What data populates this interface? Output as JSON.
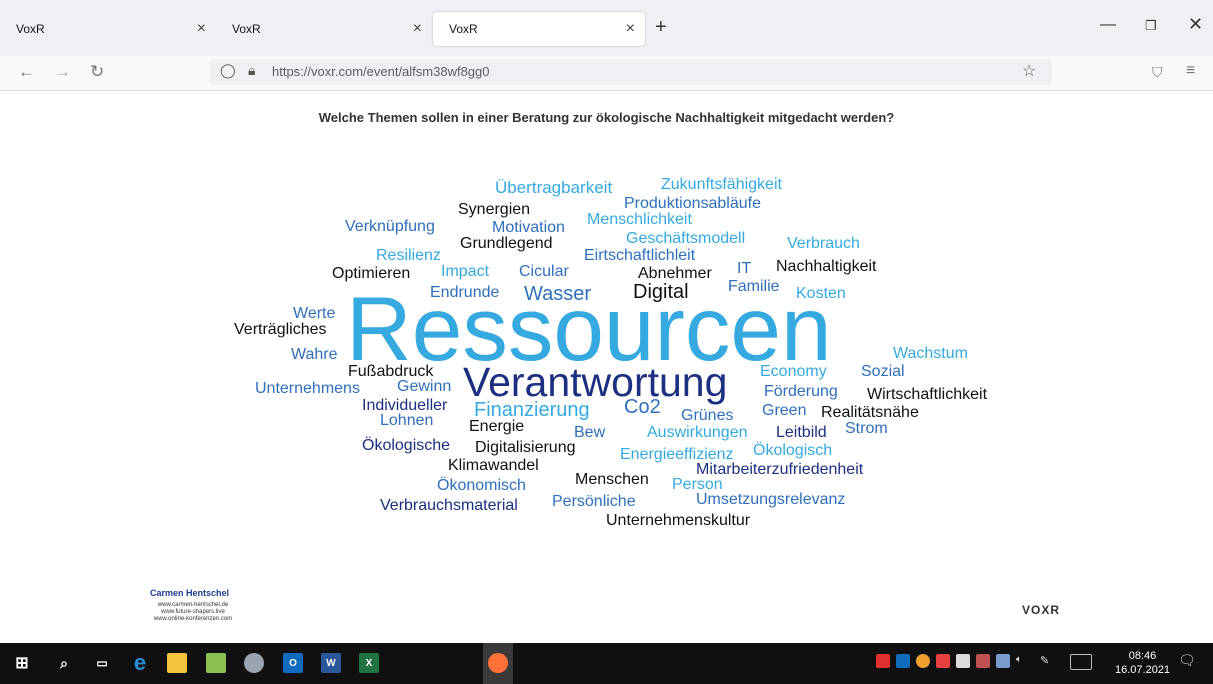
{
  "browser": {
    "tabs": [
      {
        "label": "VoxR"
      },
      {
        "label": "VoxR"
      },
      {
        "label": "VoxR"
      }
    ],
    "url": "https://voxr.com/event/alfsm38wf8gg0"
  },
  "page": {
    "question": "Welche Themen sollen in einer Beratung zur ökologische Nachhaltigkeit mitgedacht werden?",
    "footer": {
      "name": "Carmen Hentschel",
      "lines": [
        "www.carmen-hentschel.de",
        "www.future-shapers.live",
        "www.online-konferenzen.com"
      ],
      "logo": "VOXR"
    }
  },
  "colors": {
    "light_blue": "#35a9e0",
    "mid_blue": "#2f6fbb",
    "dark_blue": "#1c2f80",
    "black": "#111111"
  },
  "word_cloud": [
    {
      "text": "Ressourcen",
      "color": "light_blue"
    },
    {
      "text": "Verantwortung",
      "color": "dark_blue"
    },
    {
      "text": "Wasser",
      "color": "mid_blue"
    },
    {
      "text": "Digital",
      "color": "black"
    },
    {
      "text": "Finanzierung",
      "color": "light_blue"
    },
    {
      "text": "Co2",
      "color": "mid_blue"
    },
    {
      "text": "Übertragbarkeit",
      "color": "light_blue"
    },
    {
      "text": "Zukunftsfähigkeit",
      "color": "light_blue"
    },
    {
      "text": "Synergien",
      "color": "black"
    },
    {
      "text": "Produktionsabläufe",
      "color": "mid_blue"
    },
    {
      "text": "Verknüpfung",
      "color": "mid_blue"
    },
    {
      "text": "Motivation",
      "color": "mid_blue"
    },
    {
      "text": "Menschlichkeit",
      "color": "light_blue"
    },
    {
      "text": "Grundlegend",
      "color": "black"
    },
    {
      "text": "Geschäftsmodell",
      "color": "light_blue"
    },
    {
      "text": "Verbrauch",
      "color": "light_blue"
    },
    {
      "text": "Resilienz",
      "color": "light_blue"
    },
    {
      "text": "Eirtschaftlichleit",
      "color": "mid_blue"
    },
    {
      "text": "Optimieren",
      "color": "black"
    },
    {
      "text": "Impact",
      "color": "light_blue"
    },
    {
      "text": "Cicular",
      "color": "mid_blue"
    },
    {
      "text": "Abnehmer",
      "color": "black"
    },
    {
      "text": "IT",
      "color": "mid_blue"
    },
    {
      "text": "Nachhaltigkeit",
      "color": "black"
    },
    {
      "text": "Endrunde",
      "color": "mid_blue"
    },
    {
      "text": "Familie",
      "color": "mid_blue"
    },
    {
      "text": "Kosten",
      "color": "light_blue"
    },
    {
      "text": "Werte",
      "color": "mid_blue"
    },
    {
      "text": "Verträgliches",
      "color": "black"
    },
    {
      "text": "Wahre",
      "color": "mid_blue"
    },
    {
      "text": "Wachstum",
      "color": "light_blue"
    },
    {
      "text": "Fußabdruck",
      "color": "black"
    },
    {
      "text": "Economy",
      "color": "light_blue"
    },
    {
      "text": "Sozial",
      "color": "mid_blue"
    },
    {
      "text": "Unternehmens",
      "color": "mid_blue"
    },
    {
      "text": "Gewinn",
      "color": "mid_blue"
    },
    {
      "text": "Förderung",
      "color": "mid_blue"
    },
    {
      "text": "Wirtschaftlichkeit",
      "color": "black"
    },
    {
      "text": "Individueller",
      "color": "dark_blue"
    },
    {
      "text": "Green",
      "color": "mid_blue"
    },
    {
      "text": "Realitätsnähe",
      "color": "black"
    },
    {
      "text": "Grünes",
      "color": "mid_blue"
    },
    {
      "text": "Lohnen",
      "color": "mid_blue"
    },
    {
      "text": "Energie",
      "color": "black"
    },
    {
      "text": "Bew",
      "color": "mid_blue"
    },
    {
      "text": "Auswirkungen",
      "color": "light_blue"
    },
    {
      "text": "Leitbild",
      "color": "dark_blue"
    },
    {
      "text": "Strom",
      "color": "mid_blue"
    },
    {
      "text": "Ökologische",
      "color": "dark_blue"
    },
    {
      "text": "Digitalisierung",
      "color": "black"
    },
    {
      "text": "Energieeffizienz",
      "color": "light_blue"
    },
    {
      "text": "Ökologisch",
      "color": "light_blue"
    },
    {
      "text": "Klimawandel",
      "color": "black"
    },
    {
      "text": "Mitarbeiterzufriedenheit",
      "color": "dark_blue"
    },
    {
      "text": "Menschen",
      "color": "black"
    },
    {
      "text": "Ökonomisch",
      "color": "mid_blue"
    },
    {
      "text": "Person",
      "color": "light_blue"
    },
    {
      "text": "Persönliche",
      "color": "mid_blue"
    },
    {
      "text": "Umsetzungsrelevanz",
      "color": "mid_blue"
    },
    {
      "text": "Verbrauchsmaterial",
      "color": "dark_blue"
    },
    {
      "text": "Unternehmenskultur",
      "color": "black"
    }
  ],
  "taskbar": {
    "clock_time": "08:46",
    "clock_date": "16.07.2021"
  }
}
